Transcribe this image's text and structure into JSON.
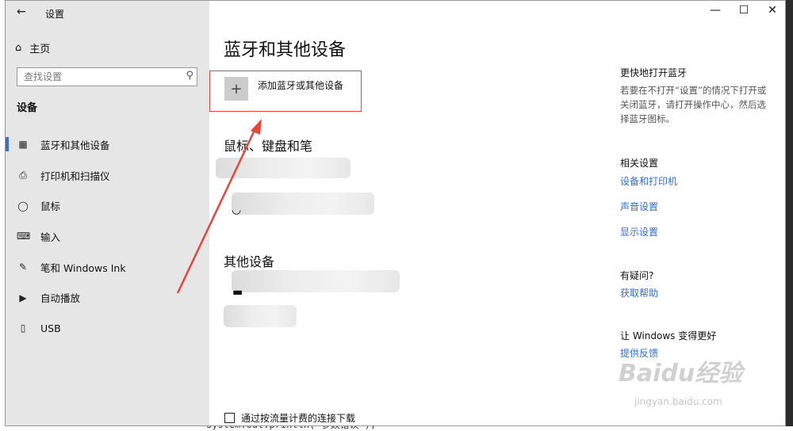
{
  "window": {
    "title": "设置",
    "back_icon": "arrow-left-icon",
    "min_icon": "minimize-icon",
    "max_icon": "maximize-icon",
    "close_icon": "close-icon"
  },
  "sidebar": {
    "home_label": "主页",
    "search_placeholder": "查找设置",
    "section_title": "设备",
    "items": [
      {
        "label": "蓝牙和其他设备",
        "icon": "bluetooth-devices-icon"
      },
      {
        "label": "打印机和扫描仪",
        "icon": "printer-icon"
      },
      {
        "label": "鼠标",
        "icon": "mouse-icon"
      },
      {
        "label": "输入",
        "icon": "keyboard-icon"
      },
      {
        "label": "笔和 Windows Ink",
        "icon": "pen-icon"
      },
      {
        "label": "自动播放",
        "icon": "autoplay-icon"
      },
      {
        "label": "USB",
        "icon": "usb-icon"
      }
    ]
  },
  "main": {
    "title": "蓝牙和其他设备",
    "add_device_label": "添加蓝牙或其他设备",
    "mouse_section": "鼠标、键盘和笔",
    "other_section": "其他设备",
    "metered_label": "通过按流量计费的连接下载"
  },
  "right": {
    "quick_title": "更快地打开蓝牙",
    "quick_text": "若要在不打开“设置”的情况下打开或关闭蓝牙，请打开操作中心，然后选择蓝牙图标。",
    "related_title": "相关设置",
    "links": [
      "设备和打印机",
      "声音设置",
      "显示设置"
    ],
    "question_title": "有疑问?",
    "help_link": "获取帮助",
    "better_title": "让 Windows 变得更好",
    "feedback_link": "提供反馈"
  },
  "background": {
    "code": "System.out.println(\"参数错误\");"
  },
  "watermark": {
    "brand": "Baidu经验",
    "url": "jingyan.baidu.com"
  },
  "colors": {
    "accent": "#3a6fd1",
    "link": "#2f6ed6",
    "annotation": "#e4463b"
  }
}
